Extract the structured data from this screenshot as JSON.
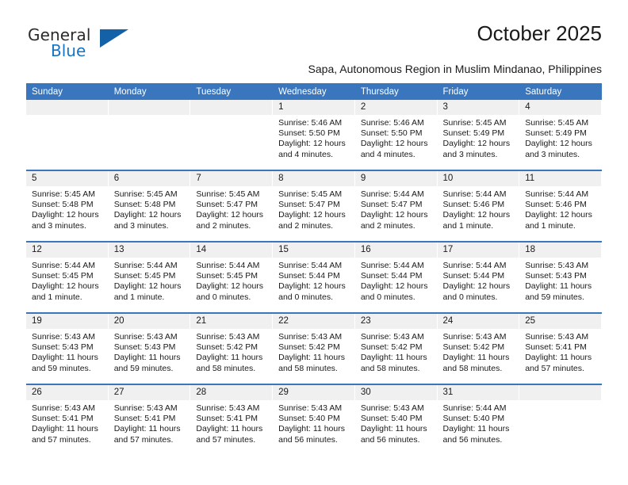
{
  "brand": {
    "name_part1": "General",
    "name_part2": "Blue",
    "triangle_color": "#1461a8",
    "blue_text_color": "#1575c4"
  },
  "header": {
    "title": "October 2025",
    "subtitle": "Sapa, Autonomous Region in Muslim Mindanao, Philippines"
  },
  "theme": {
    "header_bar_color": "#3a76bd",
    "date_band_color": "#f0f0f0",
    "text_color": "#1a1a1a"
  },
  "weekday_headers": [
    "Sunday",
    "Monday",
    "Tuesday",
    "Wednesday",
    "Thursday",
    "Friday",
    "Saturday"
  ],
  "weeks": [
    [
      {
        "date": "",
        "empty": true
      },
      {
        "date": "",
        "empty": true
      },
      {
        "date": "",
        "empty": true
      },
      {
        "date": "1",
        "sunrise": "Sunrise: 5:46 AM",
        "sunset": "Sunset: 5:50 PM",
        "daylight": "Daylight: 12 hours and 4 minutes."
      },
      {
        "date": "2",
        "sunrise": "Sunrise: 5:46 AM",
        "sunset": "Sunset: 5:50 PM",
        "daylight": "Daylight: 12 hours and 4 minutes."
      },
      {
        "date": "3",
        "sunrise": "Sunrise: 5:45 AM",
        "sunset": "Sunset: 5:49 PM",
        "daylight": "Daylight: 12 hours and 3 minutes."
      },
      {
        "date": "4",
        "sunrise": "Sunrise: 5:45 AM",
        "sunset": "Sunset: 5:49 PM",
        "daylight": "Daylight: 12 hours and 3 minutes."
      }
    ],
    [
      {
        "date": "5",
        "sunrise": "Sunrise: 5:45 AM",
        "sunset": "Sunset: 5:48 PM",
        "daylight": "Daylight: 12 hours and 3 minutes."
      },
      {
        "date": "6",
        "sunrise": "Sunrise: 5:45 AM",
        "sunset": "Sunset: 5:48 PM",
        "daylight": "Daylight: 12 hours and 3 minutes."
      },
      {
        "date": "7",
        "sunrise": "Sunrise: 5:45 AM",
        "sunset": "Sunset: 5:47 PM",
        "daylight": "Daylight: 12 hours and 2 minutes."
      },
      {
        "date": "8",
        "sunrise": "Sunrise: 5:45 AM",
        "sunset": "Sunset: 5:47 PM",
        "daylight": "Daylight: 12 hours and 2 minutes."
      },
      {
        "date": "9",
        "sunrise": "Sunrise: 5:44 AM",
        "sunset": "Sunset: 5:47 PM",
        "daylight": "Daylight: 12 hours and 2 minutes."
      },
      {
        "date": "10",
        "sunrise": "Sunrise: 5:44 AM",
        "sunset": "Sunset: 5:46 PM",
        "daylight": "Daylight: 12 hours and 1 minute."
      },
      {
        "date": "11",
        "sunrise": "Sunrise: 5:44 AM",
        "sunset": "Sunset: 5:46 PM",
        "daylight": "Daylight: 12 hours and 1 minute."
      }
    ],
    [
      {
        "date": "12",
        "sunrise": "Sunrise: 5:44 AM",
        "sunset": "Sunset: 5:45 PM",
        "daylight": "Daylight: 12 hours and 1 minute."
      },
      {
        "date": "13",
        "sunrise": "Sunrise: 5:44 AM",
        "sunset": "Sunset: 5:45 PM",
        "daylight": "Daylight: 12 hours and 1 minute."
      },
      {
        "date": "14",
        "sunrise": "Sunrise: 5:44 AM",
        "sunset": "Sunset: 5:45 PM",
        "daylight": "Daylight: 12 hours and 0 minutes."
      },
      {
        "date": "15",
        "sunrise": "Sunrise: 5:44 AM",
        "sunset": "Sunset: 5:44 PM",
        "daylight": "Daylight: 12 hours and 0 minutes."
      },
      {
        "date": "16",
        "sunrise": "Sunrise: 5:44 AM",
        "sunset": "Sunset: 5:44 PM",
        "daylight": "Daylight: 12 hours and 0 minutes."
      },
      {
        "date": "17",
        "sunrise": "Sunrise: 5:44 AM",
        "sunset": "Sunset: 5:44 PM",
        "daylight": "Daylight: 12 hours and 0 minutes."
      },
      {
        "date": "18",
        "sunrise": "Sunrise: 5:43 AM",
        "sunset": "Sunset: 5:43 PM",
        "daylight": "Daylight: 11 hours and 59 minutes."
      }
    ],
    [
      {
        "date": "19",
        "sunrise": "Sunrise: 5:43 AM",
        "sunset": "Sunset: 5:43 PM",
        "daylight": "Daylight: 11 hours and 59 minutes."
      },
      {
        "date": "20",
        "sunrise": "Sunrise: 5:43 AM",
        "sunset": "Sunset: 5:43 PM",
        "daylight": "Daylight: 11 hours and 59 minutes."
      },
      {
        "date": "21",
        "sunrise": "Sunrise: 5:43 AM",
        "sunset": "Sunset: 5:42 PM",
        "daylight": "Daylight: 11 hours and 58 minutes."
      },
      {
        "date": "22",
        "sunrise": "Sunrise: 5:43 AM",
        "sunset": "Sunset: 5:42 PM",
        "daylight": "Daylight: 11 hours and 58 minutes."
      },
      {
        "date": "23",
        "sunrise": "Sunrise: 5:43 AM",
        "sunset": "Sunset: 5:42 PM",
        "daylight": "Daylight: 11 hours and 58 minutes."
      },
      {
        "date": "24",
        "sunrise": "Sunrise: 5:43 AM",
        "sunset": "Sunset: 5:42 PM",
        "daylight": "Daylight: 11 hours and 58 minutes."
      },
      {
        "date": "25",
        "sunrise": "Sunrise: 5:43 AM",
        "sunset": "Sunset: 5:41 PM",
        "daylight": "Daylight: 11 hours and 57 minutes."
      }
    ],
    [
      {
        "date": "26",
        "sunrise": "Sunrise: 5:43 AM",
        "sunset": "Sunset: 5:41 PM",
        "daylight": "Daylight: 11 hours and 57 minutes."
      },
      {
        "date": "27",
        "sunrise": "Sunrise: 5:43 AM",
        "sunset": "Sunset: 5:41 PM",
        "daylight": "Daylight: 11 hours and 57 minutes."
      },
      {
        "date": "28",
        "sunrise": "Sunrise: 5:43 AM",
        "sunset": "Sunset: 5:41 PM",
        "daylight": "Daylight: 11 hours and 57 minutes."
      },
      {
        "date": "29",
        "sunrise": "Sunrise: 5:43 AM",
        "sunset": "Sunset: 5:40 PM",
        "daylight": "Daylight: 11 hours and 56 minutes."
      },
      {
        "date": "30",
        "sunrise": "Sunrise: 5:43 AM",
        "sunset": "Sunset: 5:40 PM",
        "daylight": "Daylight: 11 hours and 56 minutes."
      },
      {
        "date": "31",
        "sunrise": "Sunrise: 5:44 AM",
        "sunset": "Sunset: 5:40 PM",
        "daylight": "Daylight: 11 hours and 56 minutes."
      },
      {
        "date": "",
        "empty": true
      }
    ]
  ]
}
